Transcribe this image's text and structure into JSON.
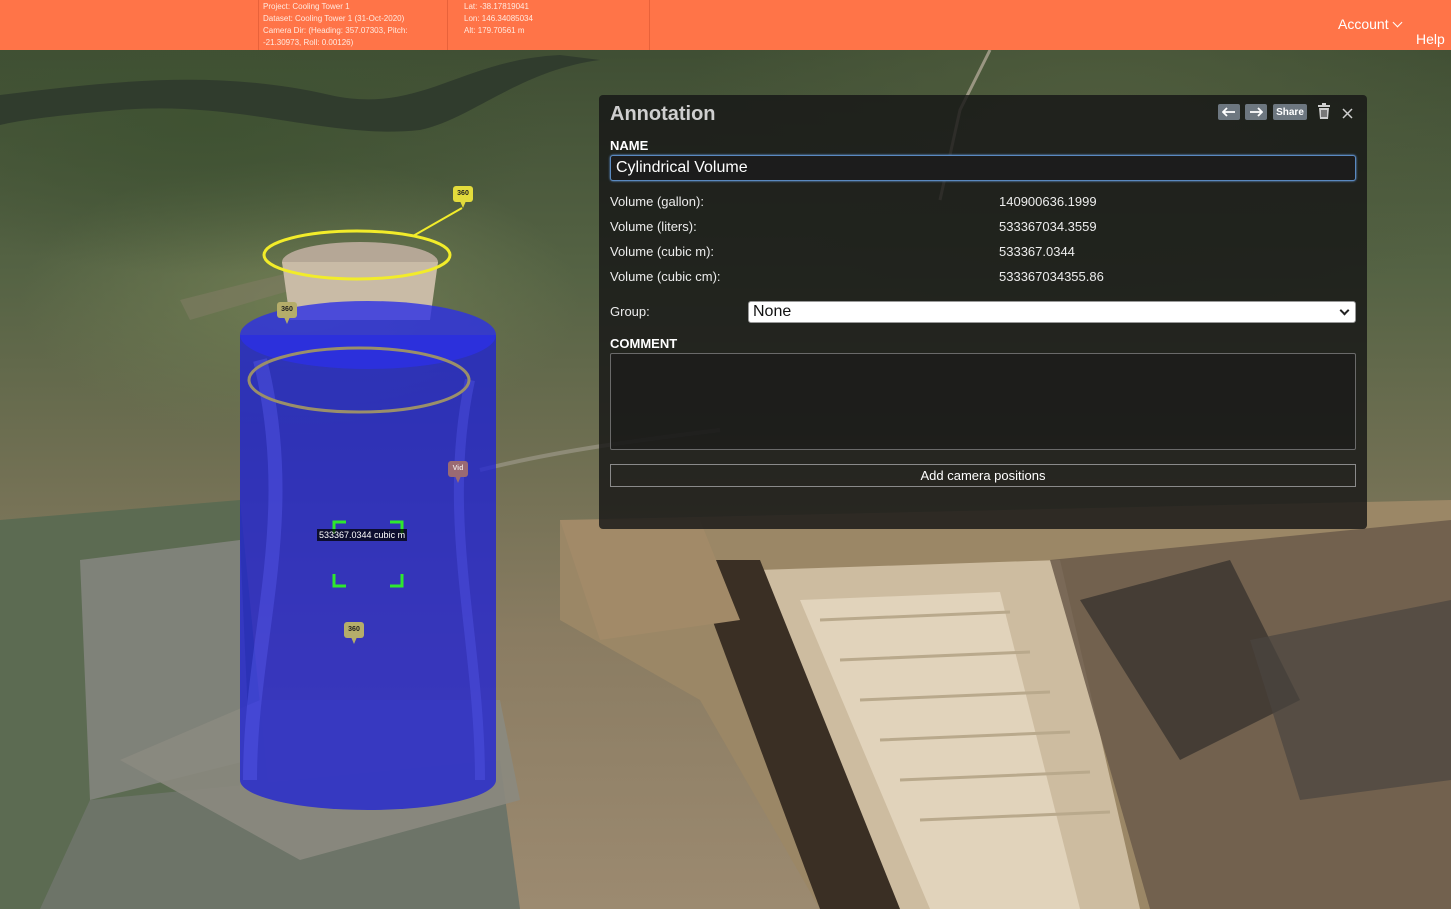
{
  "topbar": {
    "project": "Project: Cooling Tower 1",
    "dataset": "Dataset: Cooling Tower 1 (31-Oct-2020)",
    "camera_dir_1": "Camera Dir: (Heading: 357.07303, Pitch:",
    "camera_dir_2": "-21.30973, Roll: 0.00126)",
    "lat": "Lat: -38.17819041",
    "lon": "Lon: 146.34085034",
    "alt": "Alt: 179.70561 m",
    "account_label": "Account",
    "help_label": "Help",
    "color": "#ff7448"
  },
  "annotation": {
    "title": "Annotation",
    "share_label": "Share",
    "name_label": "NAME",
    "name_value": "Cylindrical Volume",
    "volumes": [
      {
        "label": "Volume (gallon):",
        "value": "140900636.1999"
      },
      {
        "label": "Volume (liters):",
        "value": "533367034.3559"
      },
      {
        "label": "Volume (cubic m):",
        "value": "533367.0344"
      },
      {
        "label": "Volume (cubic cm):",
        "value": "533367034355.86"
      }
    ],
    "group_label": "Group:",
    "group_value": "None",
    "comment_label": "COMMENT",
    "comment_value": "",
    "add_camera_label": "Add camera positions"
  },
  "scene": {
    "marker_top": "360",
    "marker_left": "360",
    "marker_center": "360",
    "marker_vid": "Vid",
    "volume_label": "533367.0344 cubic m",
    "cylinder_color": "#1b1fd8",
    "ring_color": "#f2ec2a"
  }
}
